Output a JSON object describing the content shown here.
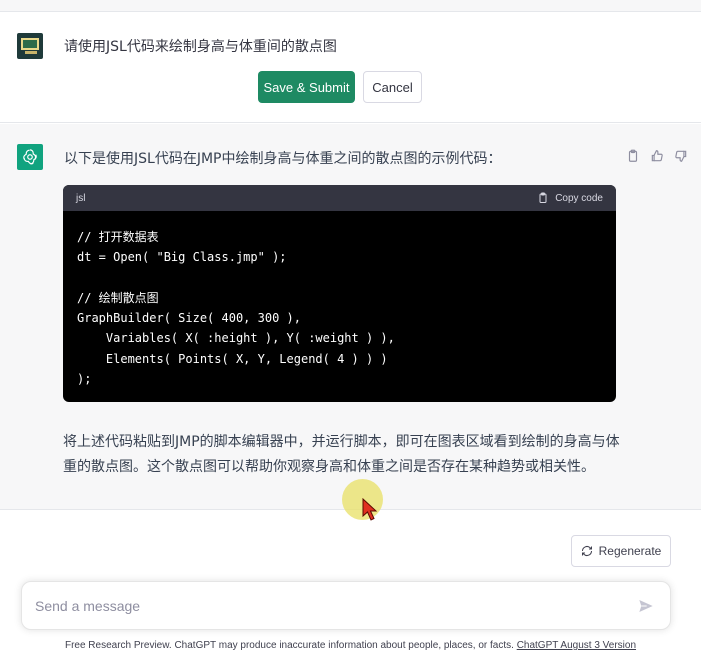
{
  "user_message": {
    "text": "请使用JSL代码来绘制身高与体重间的散点图",
    "save_label": "Save & Submit",
    "cancel_label": "Cancel"
  },
  "assistant_message": {
    "intro": "以下是使用JSL代码在JMP中绘制身高与体重之间的散点图的示例代码：",
    "code_lang": "jsl",
    "copy_label": "Copy code",
    "code": "// 打开数据表\ndt = Open( \"Big Class.jmp\" );\n\n// 绘制散点图\nGraphBuilder( Size( 400, 300 ),\n    Variables( X( :height ), Y( :weight ) ),\n    Elements( Points( X, Y, Legend( 4 ) ) )\n);",
    "outro": "将上述代码粘贴到JMP的脚本编辑器中，并运行脚本，即可在图表区域看到绘制的身高与体重的散点图。这个散点图可以帮助你观察身高和体重之间是否存在某种趋势或相关性。"
  },
  "regenerate_label": "Regenerate",
  "composer": {
    "placeholder": "Send a message"
  },
  "footer": {
    "text": "Free Research Preview. ChatGPT may produce inaccurate information about people, places, or facts. ",
    "link": "ChatGPT August 3 Version"
  },
  "colors": {
    "accent": "#1e8a63",
    "code_bg": "#000000",
    "code_header": "#343541"
  }
}
